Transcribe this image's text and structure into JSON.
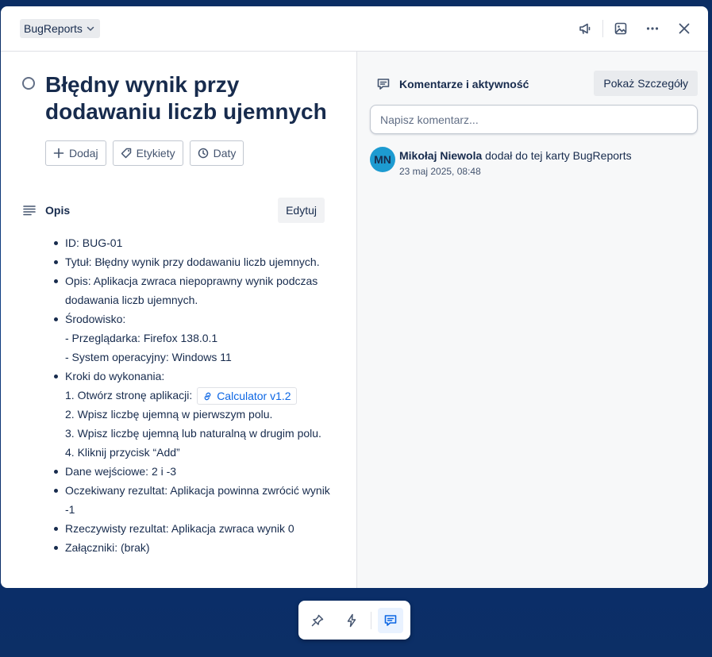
{
  "header": {
    "list_name": "BugReports"
  },
  "card": {
    "title": "Błędny wynik przy dodawaniu liczb ujemnych",
    "chips": [
      {
        "label": "Dodaj",
        "icon": "plus-icon"
      },
      {
        "label": "Etykiety",
        "icon": "label-icon"
      },
      {
        "label": "Daty",
        "icon": "clock-icon"
      }
    ]
  },
  "description": {
    "heading": "Opis",
    "edit_label": "Edytuj",
    "lines": {
      "id": "ID: BUG-01",
      "tytul": "Tytuł: Błędny wynik przy dodawaniu liczb ujemnych.",
      "opis": "Opis: Aplikacja zwraca niepoprawny wynik podczas dodawania liczb ujemnych.",
      "srodowisko": "Środowisko:",
      "env_browser": "- Przeglądarka: Firefox 138.0.1",
      "env_os": "- System operacyjny: Windows 11",
      "kroki": "Kroki do wykonania:",
      "step1_prefix": "1. Otwórz stronę aplikacji:",
      "step1_link": "Calculator v1.2",
      "step2": "2. Wpisz liczbę ujemną w pierwszym polu.",
      "step3": "3. Wpisz liczbę ujemną lub naturalną w drugim polu.",
      "step4": "4. Kliknij przycisk “Add”",
      "dane": "Dane wejściowe: 2 i -3",
      "oczekiwany": "Oczekiwany rezultat: Aplikacja powinna zwrócić wynik -1",
      "rzeczywisty": "Rzeczywisty rezultat: Aplikacja zwraca wynik 0",
      "zalaczniki": "Załączniki: (brak)"
    }
  },
  "comments": {
    "heading": "Komentarze i aktywność",
    "details_label": "Pokaż Szczegóły",
    "input_placeholder": "Napisz komentarz...",
    "activity": {
      "initials": "MN",
      "user": "Mikołaj Niewola",
      "action": "dodał do tej karty BugReports",
      "timestamp": "23 maj 2025, 08:48"
    }
  },
  "colors": {
    "accent": "#0c66e4",
    "avatar": "#1d9bd1",
    "text": "#172b4d"
  }
}
